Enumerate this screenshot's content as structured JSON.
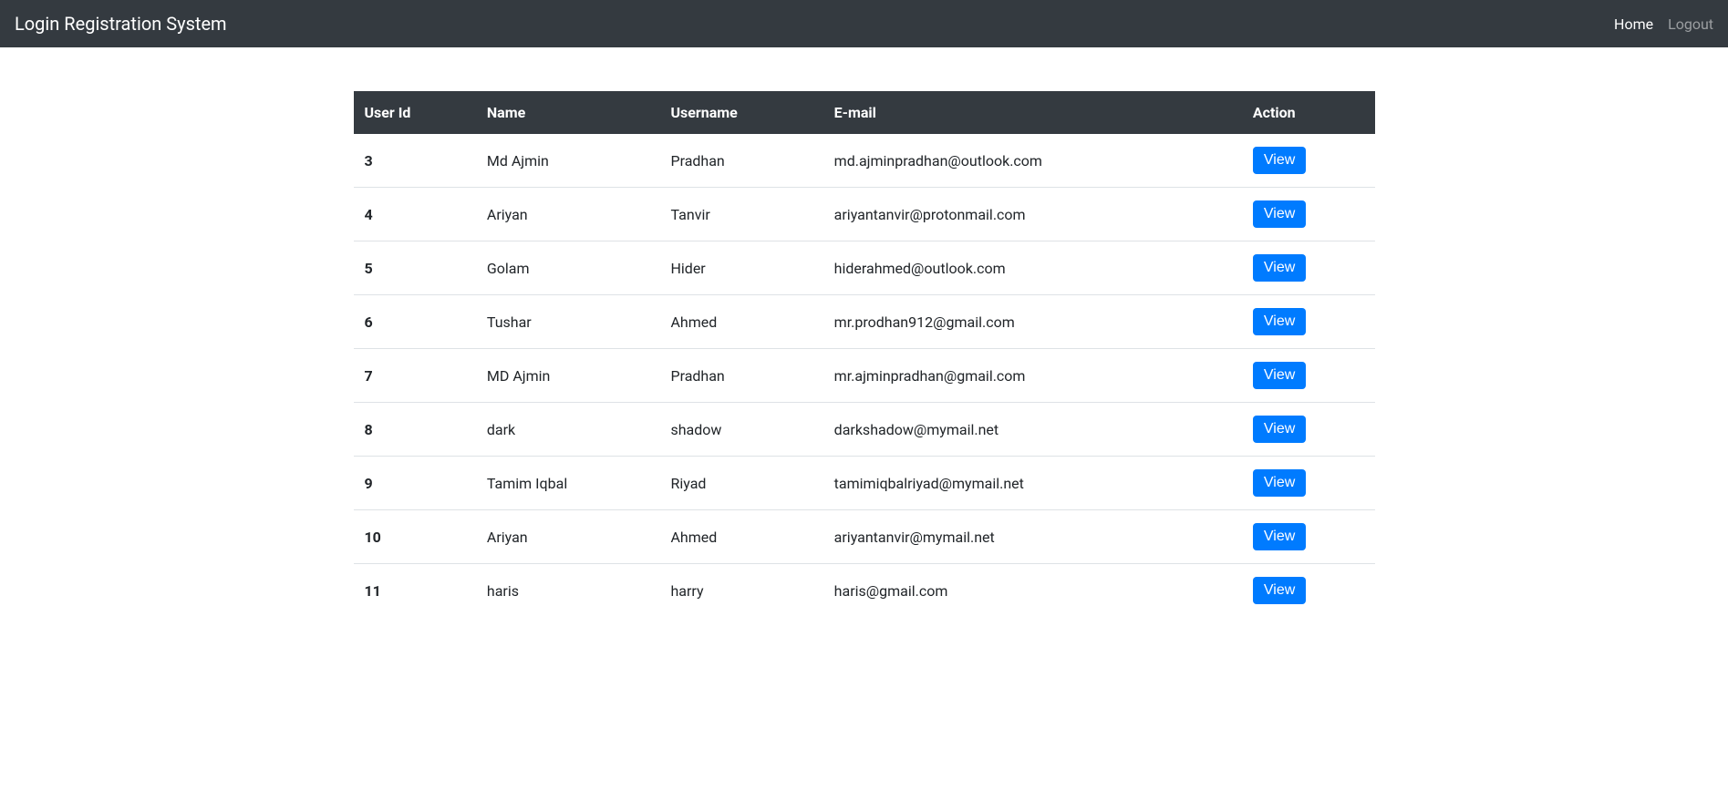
{
  "navbar": {
    "brand": "Login Registration System",
    "links": [
      {
        "label": "Home",
        "active": true
      },
      {
        "label": "Logout",
        "active": false
      }
    ]
  },
  "table": {
    "headers": {
      "id": "User Id",
      "name": "Name",
      "username": "Username",
      "email": "E-mail",
      "action": "Action"
    },
    "action_label": "View",
    "rows": [
      {
        "id": "3",
        "name": "Md Ajmin",
        "username": "Pradhan",
        "email": "md.ajminpradhan@outlook.com"
      },
      {
        "id": "4",
        "name": "Ariyan",
        "username": "Tanvir",
        "email": "ariyantanvir@protonmail.com"
      },
      {
        "id": "5",
        "name": "Golam",
        "username": "Hider",
        "email": "hiderahmed@outlook.com"
      },
      {
        "id": "6",
        "name": "Tushar",
        "username": "Ahmed",
        "email": "mr.prodhan912@gmail.com"
      },
      {
        "id": "7",
        "name": "MD Ajmin",
        "username": "Pradhan",
        "email": "mr.ajminpradhan@gmail.com"
      },
      {
        "id": "8",
        "name": "dark",
        "username": "shadow",
        "email": "darkshadow@mymail.net"
      },
      {
        "id": "9",
        "name": "Tamim Iqbal",
        "username": "Riyad",
        "email": "tamimiqbalriyad@mymail.net"
      },
      {
        "id": "10",
        "name": "Ariyan",
        "username": "Ahmed",
        "email": "ariyantanvir@mymail.net"
      },
      {
        "id": "11",
        "name": "haris",
        "username": "harry",
        "email": "haris@gmail.com"
      }
    ]
  }
}
